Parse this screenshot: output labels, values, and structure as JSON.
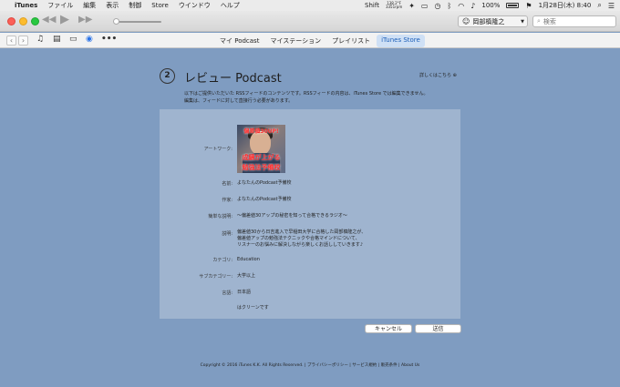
{
  "menubar": {
    "app_name": "iTunes",
    "menus": [
      "ファイル",
      "編集",
      "表示",
      "制御",
      "Store",
      "ウインドウ",
      "ヘルプ"
    ],
    "shift_label": "Shift",
    "meter_top": "138.2°F",
    "meter_bottom": "3351rpm",
    "battery": "100%",
    "date_time": "1月28日(木)  8:40"
  },
  "toolbar": {
    "account_name": "岡部槙隆之",
    "search_placeholder": "検索"
  },
  "nav": {
    "tabs": [
      {
        "label": "マイ Podcast",
        "active": false
      },
      {
        "label": "マイステーション",
        "active": false
      },
      {
        "label": "プレイリスト",
        "active": false
      },
      {
        "label": "iTunes Store",
        "active": true
      }
    ]
  },
  "review": {
    "step": "2",
    "title": "レビュー Podcast",
    "learn_more": "詳しくはこちら",
    "intro_line1": "以下はご提供いただいた RSSフィードのコンテンツです。RSSフィードの内容は、iTunes Store では編集できません。",
    "intro_line2": "編集は、フィードに対して直接行う必要があります。",
    "fields": {
      "artwork_label": "アートワーク:",
      "name_label": "名前:",
      "name_value": "よなたんのPodcast予備校",
      "author_label": "作家:",
      "author_value": "よなたんのPodcast予備校",
      "short_desc_label": "簡単な説明:",
      "short_desc_value": "〜偏差値30アップの秘密を知って合格できるラジオ〜",
      "desc_label": "説明:",
      "desc_line1": "偏差値30から日吉進入で早稲田大学に合格した岡部槙隆之が、",
      "desc_line2": "偏差値アップの勉強法テクニックや合格マインドについて、",
      "desc_line3": "リスナーのお悩みに解決しながら楽しくお話ししていきます♪",
      "category_label": "カテゴリ:",
      "category_value": "Education",
      "subcategory_label": "サブカテゴリー:",
      "subcategory_value": "大学以上",
      "language_label": "言語:",
      "language_value": "日本語",
      "clean_value": "はクリーンです"
    },
    "artwork_text_1": "偏差値30UP!",
    "artwork_text_2": "成績が上がる",
    "artwork_text_3": "勉強法予備校"
  },
  "buttons": {
    "cancel": "キャンセル",
    "send": "送信"
  },
  "footer": "Copyright © 2016 iTunes K.K. All Rights Reserved. | プライバシーポリシー | サービス規約 | 販売条件 | About Us"
}
